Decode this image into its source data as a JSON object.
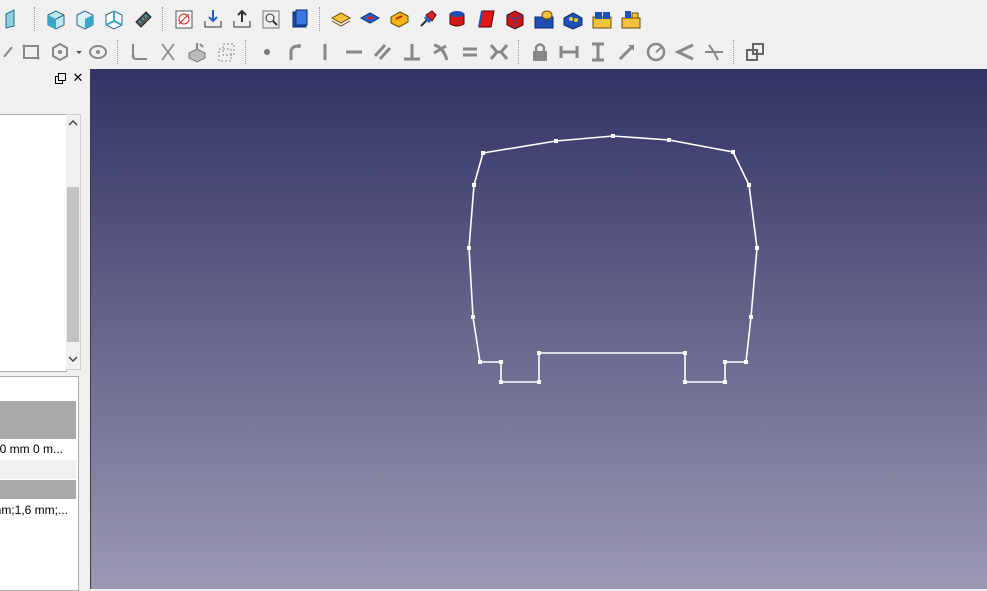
{
  "toolbar_top": {
    "icons": [
      "view-right-icon",
      "view-isometric-front-icon",
      "view-isometric-icon",
      "view-box-icon",
      "measure-ruler-icon",
      "part-box-icon",
      "import-icon",
      "export-icon",
      "inspect-icon",
      "part-design-icon",
      "sketch-yellow-icon",
      "pad-red-blue-icon",
      "pocket-yellow-icon",
      "attach-pin-icon",
      "revolve-icon",
      "chamfer-icon",
      "part-cube-icon",
      "datum-yellow-icon",
      "multi-blue-icon",
      "assembly-yellow-icon",
      "assembly-yellow-2-icon"
    ]
  },
  "toolbar_constraints": {
    "icons": [
      "rectangle-icon",
      "polygon-icon",
      "dropdown-arrow-icon",
      "circle-slot-icon",
      "fillet-icon",
      "trim-icon",
      "external-geometry-icon",
      "carbon-copy-icon",
      "point-constraint-icon",
      "tangent-icon",
      "vertical-icon",
      "horizontal-icon",
      "parallel-icon",
      "perpendicular-icon",
      "tangent-curve-icon",
      "equal-icon",
      "symmetric-icon",
      "lock-icon",
      "horizontal-distance-icon",
      "vertical-distance-icon",
      "distance-icon",
      "radius-icon",
      "angle-icon",
      "snell-icon",
      "toggle-construction-icon"
    ]
  },
  "panel": {
    "close_label": "✕",
    "props_rows": [
      {
        "kind": "blank",
        "text": ""
      },
      {
        "kind": "group",
        "text": ""
      },
      {
        "kind": "group",
        "text": ""
      },
      {
        "kind": "value",
        "text": "0 mm  0 m..."
      },
      {
        "kind": "alt",
        "text": ""
      },
      {
        "kind": "group",
        "text": ""
      },
      {
        "kind": "value",
        "text": "nm;1,6 mm;..."
      }
    ]
  },
  "view": {
    "background_top": "#333366",
    "background_bottom": "#9a98b2",
    "sketch_color": "#ffffff"
  }
}
